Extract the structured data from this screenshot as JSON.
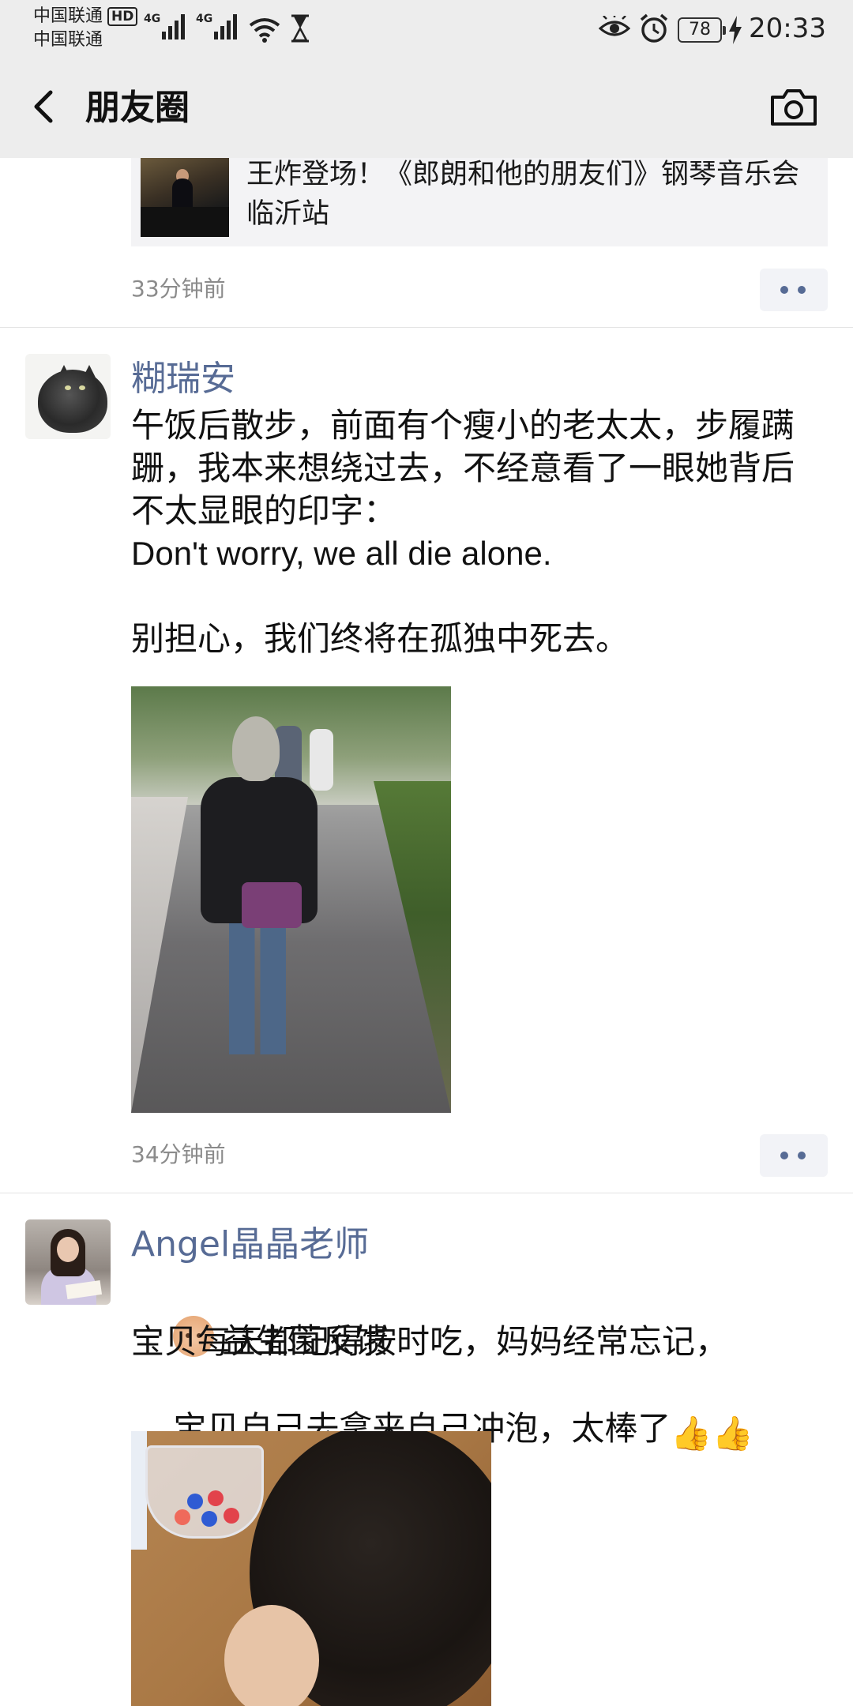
{
  "status_bar": {
    "carrier1": "中国联通",
    "carrier2": "中国联通",
    "hd_badge": "HD",
    "network1": "4G",
    "network2": "4G",
    "battery": "78",
    "time": "20:33",
    "icons": [
      "wifi-icon",
      "hourglass-icon",
      "eye-icon",
      "alarm-icon",
      "charging-bolt-icon"
    ]
  },
  "nav": {
    "title": "朋友圈",
    "back_icon": "chevron-left-icon",
    "camera_icon": "camera-icon"
  },
  "posts": [
    {
      "link_card": {
        "title": "王炸登场！《郎朗和他的朋友们》钢琴音乐会临沂站"
      },
      "time": "33分钟前"
    },
    {
      "author": "糊瑞安",
      "text_cn": "午饭后散步，前面有个瘦小的老太太，步履蹒跚，我本来想绕过去，不经意看了一眼她背后不太显眼的印字：",
      "text_en": "Don't worry, we all die alone.",
      "text_cn2": "别担心，我们终将在孤独中死去。",
      "time": "34分钟前"
    },
    {
      "author": "Angel晶晶老师",
      "line1": "益生菌反馈",
      "line2": "宝贝每天都记得按时吃，妈妈经常忘记，",
      "line3": "宝贝自己去拿来自己冲泡，太棒了",
      "thumbs": "👍👍"
    }
  ],
  "colors": {
    "bar_bg": "#ededed",
    "author_blue": "#576b95",
    "timestamp_gray": "#8b8b8b",
    "link_card_bg": "#f3f3f5"
  }
}
